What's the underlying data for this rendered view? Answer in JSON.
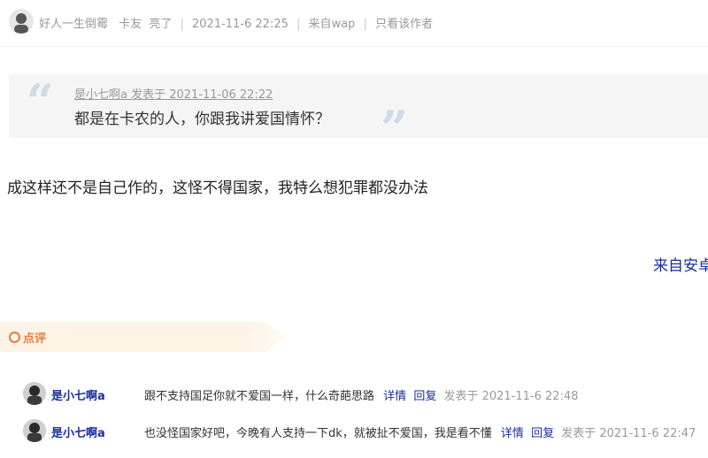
{
  "header": {
    "username": "好人一生倒霉",
    "title": "卡友",
    "level": "亮了",
    "time": "2021-11-6 22:25",
    "source": "来自wap",
    "only_author": "只看该作者"
  },
  "quote": {
    "meta": "是小七啊a 发表于 2021-11-06 22:22",
    "text": "都是在卡农的人，你跟我讲爱国情怀？"
  },
  "post": {
    "text": "成这样还不是自己作的，这怪不得国家，我特么想犯罪都没办法",
    "source_link": "来自安卓"
  },
  "comments": {
    "section_title": "点评",
    "items": [
      {
        "user": "是小七啊a",
        "text": "跟不支持国足你就不爱国一样，什么奇葩思路",
        "detail": "详情",
        "reply": "回复",
        "time": "发表于 2021-11-6 22:48"
      },
      {
        "user": "是小七啊a",
        "text": "也没怪国家好吧，今晚有人支持一下dk，就被扯不爱国，我是看不懂",
        "detail": "详情",
        "reply": "回复",
        "time": "发表于 2021-11-6 22:47"
      }
    ]
  }
}
